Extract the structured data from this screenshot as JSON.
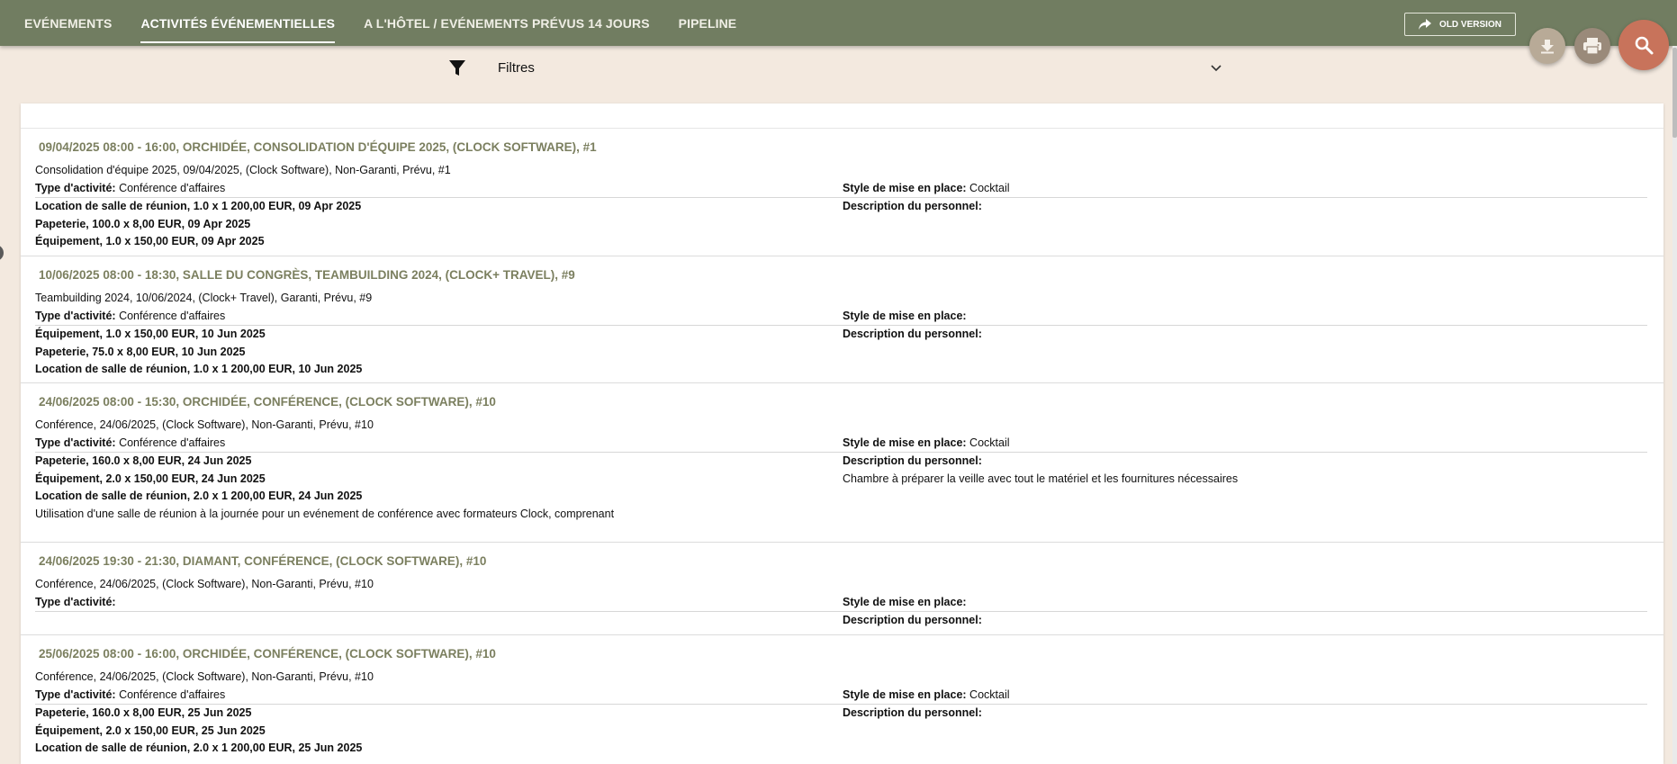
{
  "nav": {
    "tabs": [
      {
        "label": "EVÉNEMENTS"
      },
      {
        "label": "ACTIVITÉS ÉVÉNEMENTIELLES"
      },
      {
        "label": "A L'HÔTEL / EVÉNEMENTS PRÉVUS 14 JOURS"
      },
      {
        "label": "PIPELINE"
      }
    ],
    "old_version_label": "OLD VERSION"
  },
  "filters": {
    "label": "Filtres"
  },
  "labels": {
    "type": "Type d'activité:",
    "style": "Style de mise en place:",
    "staff": "Description du personnel:"
  },
  "events": [
    {
      "title": "09/04/2025 08:00 - 16:00, ORCHIDÉE, CONSOLIDATION D'ÉQUIPE 2025, (CLOCK SOFTWARE), #1",
      "summary": "Consolidation d'équipe 2025, 09/04/2025, (Clock Software), Non-Garanti, Prévu, #1",
      "type_value": "Conférence d'affaires",
      "style_value": "Cocktail",
      "items": [
        "Location de salle de réunion, 1.0 x 1 200,00 EUR, 09 Apr 2025",
        "Papeterie, 100.0 x 8,00 EUR, 09 Apr 2025",
        "Équipement, 1.0 x 150,00 EUR, 09 Apr 2025"
      ]
    },
    {
      "title": "10/06/2025 08:00 - 18:30, SALLE DU CONGRÈS, TEAMBUILDING 2024, (CLOCK+ TRAVEL), #9",
      "summary": "Teambuilding 2024, 10/06/2024, (Clock+ Travel), Garanti, Prévu, #9",
      "type_value": "Conférence d'affaires",
      "style_value": "",
      "items": [
        "Équipement, 1.0 x 150,00 EUR, 10 Jun 2025",
        "Papeterie, 75.0 x 8,00 EUR, 10 Jun 2025",
        "Location de salle de réunion, 1.0 x 1 200,00 EUR, 10 Jun 2025"
      ]
    },
    {
      "title": "24/06/2025 08:00 - 15:30, ORCHIDÉE, CONFÉRENCE, (CLOCK SOFTWARE), #10",
      "summary": "Conférence, 24/06/2025, (Clock Software), Non-Garanti, Prévu, #10",
      "type_value": "Conférence d'affaires",
      "style_value": "Cocktail",
      "staff_value": "Chambre à préparer la veille avec tout le matériel et les fournitures nécessaires",
      "items": [
        "Papeterie, 160.0 x 8,00 EUR, 24 Jun 2025",
        "Équipement, 2.0 x 150,00 EUR, 24 Jun 2025",
        "Location de salle de réunion, 2.0 x 1 200,00 EUR, 24 Jun 2025"
      ],
      "note": "Utilisation d'une salle de réunion à la journée pour un evénement de conférence avec formateurs Clock, comprenant"
    },
    {
      "title": "24/06/2025 19:30 - 21:30, DIAMANT, CONFÉRENCE, (CLOCK SOFTWARE), #10",
      "summary": "Conférence, 24/06/2025, (Clock Software), Non-Garanti, Prévu, #10",
      "type_value": "",
      "style_value": ""
    },
    {
      "title": "25/06/2025 08:00 - 16:00, ORCHIDÉE, CONFÉRENCE, (CLOCK SOFTWARE), #10",
      "summary": "Conférence, 24/06/2025, (Clock Software), Non-Garanti, Prévu, #10",
      "type_value": "Conférence d'affaires",
      "style_value": "Cocktail",
      "items": [
        "Papeterie, 160.0 x 8,00 EUR, 25 Jun 2025",
        "Équipement, 2.0 x 150,00 EUR, 25 Jun 2025",
        "Location de salle de réunion, 2.0 x 1 200,00 EUR, 25 Jun 2025"
      ]
    }
  ]
}
